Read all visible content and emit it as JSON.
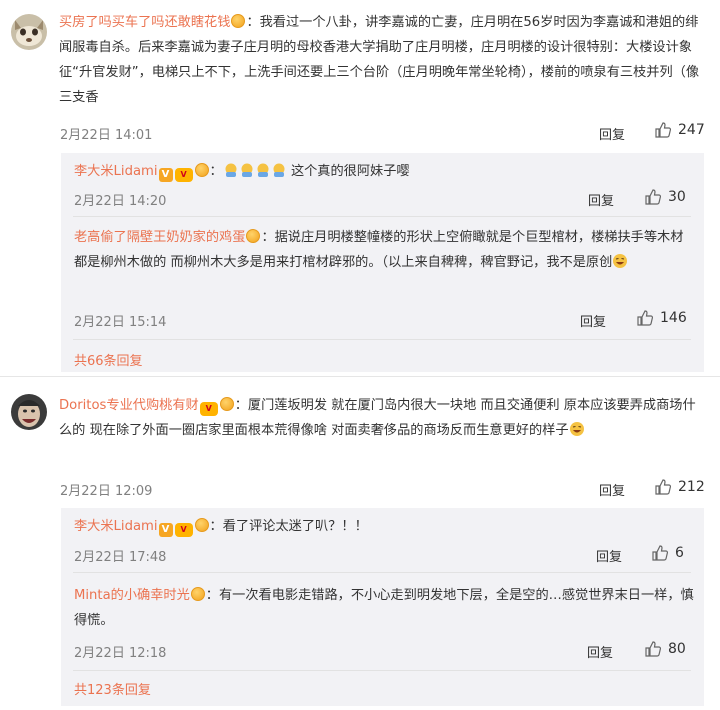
{
  "comments": [
    {
      "username": "买房了吗买车了吗还敢瞎花钱",
      "text": "：我看过一个八卦，讲李嘉诚的亡妻，庄月明在56岁时因为李嘉诚和港姐的绯闻服毒自杀。后来李嘉诚为妻子庄月明的母校香港大学捐助了庄月明楼，庄月明楼的设计很特别：大楼设计象征“升官发财”，电梯只上不下，上洗手间还要上三个台阶（庄月明晚年常坐轮椅），楼前的喷泉有三枝并列（像三支香",
      "date": "2月22日 14:01",
      "reply_label": "回复",
      "likes": "247",
      "replies": [
        {
          "username": "李大米Lidami",
          "text": "：",
          "tail": "这个真的很阿妹子嘤",
          "date": "2月22日 14:20",
          "reply_label": "回复",
          "likes": "30"
        },
        {
          "username": "老高偷了隔壁王奶奶家的鸡蛋",
          "text": "：据说庄月明楼整幢楼的形状上空俯瞰就是个巨型棺材，楼梯扶手等木材都是柳州木做的 而柳州木大多是用来打棺材辟邪的。（以上来自稗稗，稗官野记，我不是原创",
          "date": "2月22日 15:14",
          "reply_label": "回复",
          "likes": "146"
        }
      ],
      "more_replies": "共66条回复"
    },
    {
      "username": "Doritos专业代购桃有财",
      "text": "：厦门莲坂明发 就在厦门岛内很大一块地 而且交通便利 原本应该要弄成商场什么的 现在除了外面一圈店家里面根本荒得像啥 对面卖奢侈品的商场反而生意更好的样子",
      "date": "2月22日 12:09",
      "reply_label": "回复",
      "likes": "212",
      "replies": [
        {
          "username": "李大米Lidami",
          "text": "：看了评论太迷了叭？！！",
          "date": "2月22日 17:48",
          "reply_label": "回复",
          "likes": "6"
        },
        {
          "username": "Minta的小确幸时光",
          "text": "：有一次看电影走错路，不小心走到明发地下层，全是空的…感觉世界末日一样，慎得慌。",
          "date": "2月22日 12:18",
          "reply_label": "回复",
          "likes": "80"
        }
      ],
      "more_replies": "共123条回复"
    }
  ],
  "icons": [
    "avatar-dog-icon",
    "avatar-man-icon",
    "gold-badge-icon",
    "v-badge-icon",
    "vip-badge-icon",
    "thumbs-up-icon",
    "crying-emoji-icon",
    "laugh-emoji-icon"
  ],
  "colors": {
    "username": "#eb7350",
    "meta": "#808080",
    "reply_bg": "#f2f2f5",
    "text": "#333333"
  }
}
